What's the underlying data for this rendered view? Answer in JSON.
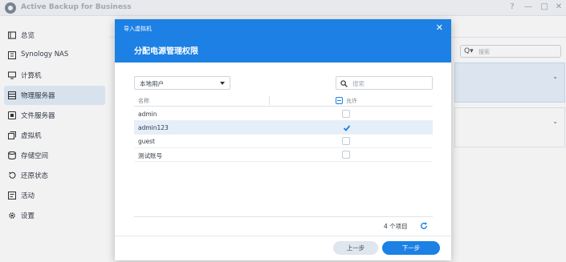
{
  "window": {
    "title": "Active Backup for Business",
    "controls": [
      "?",
      "—",
      "□",
      "✕"
    ]
  },
  "sidebar": {
    "items": [
      {
        "label": "总览",
        "icon": "overview-icon"
      },
      {
        "label": "Synology NAS",
        "icon": "nas-icon"
      },
      {
        "label": "计算机",
        "icon": "computer-icon"
      },
      {
        "label": "物理服务器",
        "icon": "server-icon",
        "active": true
      },
      {
        "label": "文件服务器",
        "icon": "file-server-icon"
      },
      {
        "label": "虚拟机",
        "icon": "virtual-machine-icon"
      },
      {
        "label": "存储空间",
        "icon": "storage-icon"
      },
      {
        "label": "还原状态",
        "icon": "restore-icon"
      },
      {
        "label": "活动",
        "icon": "activity-icon"
      },
      {
        "label": "设置",
        "icon": "settings-icon"
      }
    ]
  },
  "background": {
    "search_placeholder": "搜索",
    "search_icon": "Q▾"
  },
  "dialog": {
    "header_small": "导入虚拟机",
    "close_icon": "✕",
    "title": "分配电源管理权限",
    "user_type": "本地用户",
    "search_placeholder": "搜索",
    "columns": {
      "name": "名称",
      "allow": "允许"
    },
    "rows": [
      {
        "name": "admin",
        "allowed": false,
        "selected": false
      },
      {
        "name": "admin123",
        "allowed": true,
        "selected": true
      },
      {
        "name": "guest",
        "allowed": false,
        "selected": false
      },
      {
        "name": "测试账号",
        "allowed": false,
        "selected": false
      }
    ],
    "footer_count": "4 个项目",
    "buttons": {
      "prev": "上一步",
      "next": "下一步"
    }
  },
  "colors": {
    "accent": "#1c80e4",
    "selected_row": "#e5effa",
    "sidebar_active": "#e3eef9"
  }
}
